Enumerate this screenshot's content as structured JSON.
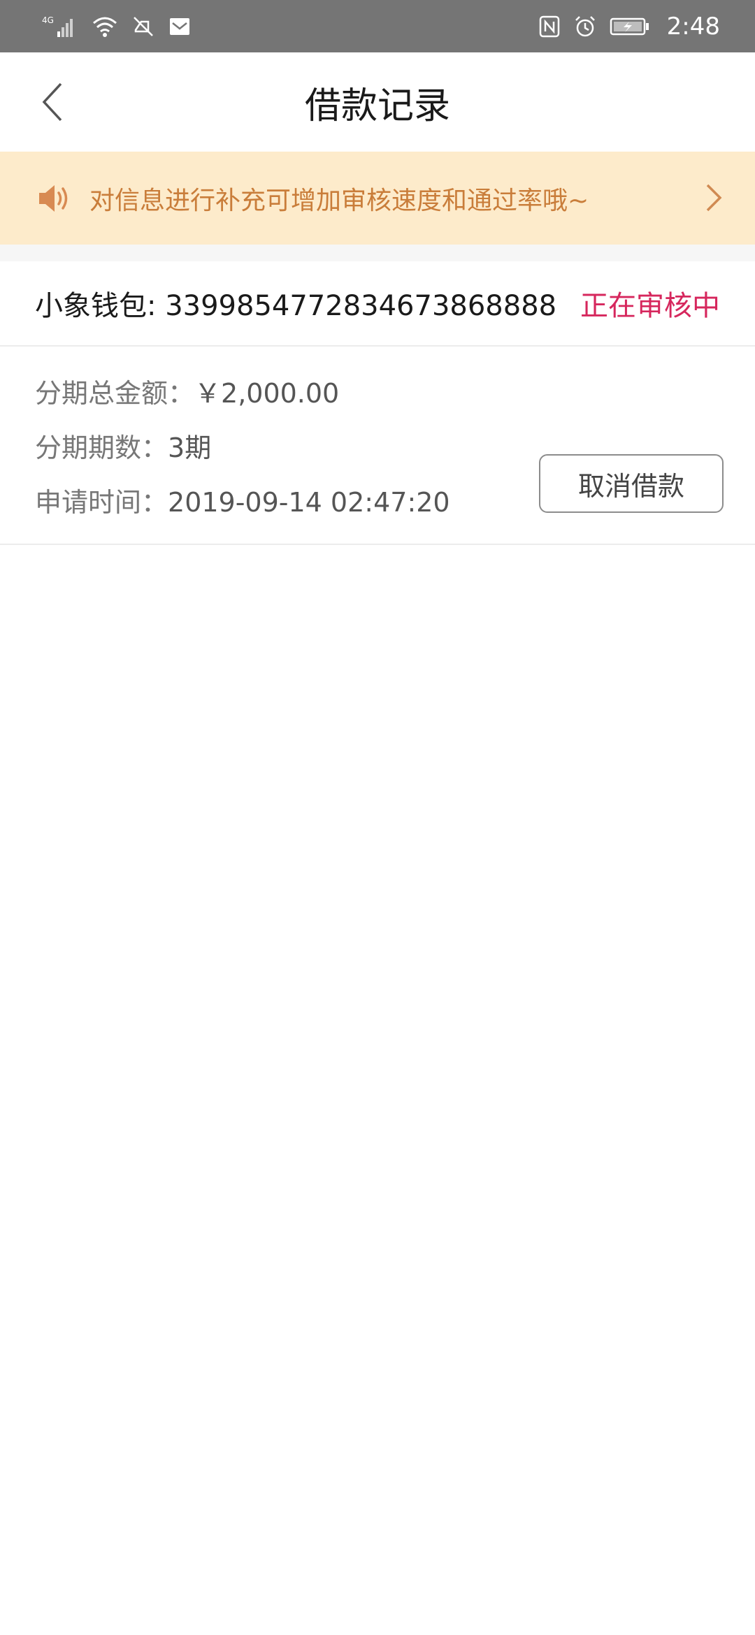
{
  "status_bar": {
    "network": "4G",
    "time": "2:48"
  },
  "navbar": {
    "title": "借款记录"
  },
  "notice": {
    "text": "对信息进行补充可增加审核速度和通过率哦~",
    "color": "#c97d3a",
    "background": "#fdebcb"
  },
  "record": {
    "product_prefix": "小象钱包: ",
    "order_no": "3399854772834673868888",
    "status": "正在审核中",
    "status_color": "#d6275d",
    "amount_label": "分期总金额：",
    "amount_value": "￥2,000.00",
    "periods_label": "分期期数：",
    "periods_value": "3期",
    "time_label": "申请时间：",
    "time_value": "2019-09-14 02:47:20",
    "cancel_label": "取消借款"
  }
}
